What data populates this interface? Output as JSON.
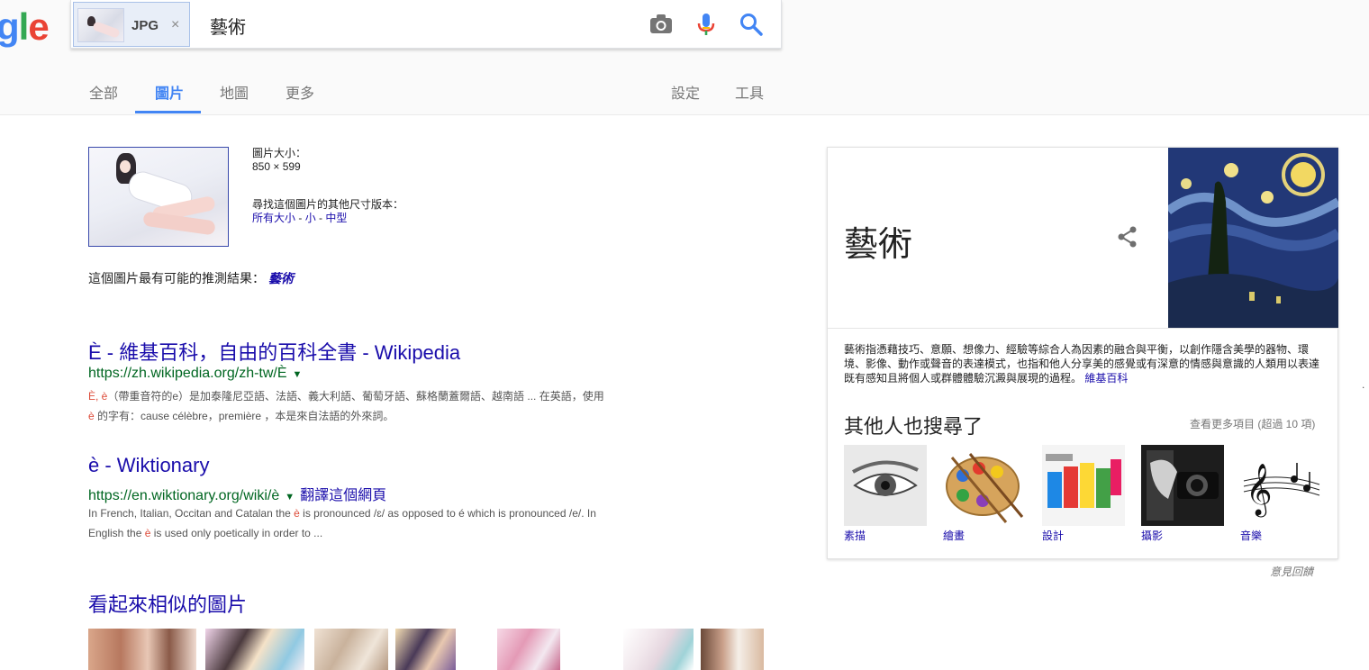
{
  "logo": {
    "text_partial": [
      "g",
      "l",
      "e"
    ]
  },
  "search": {
    "chip_label": "JPG",
    "chip_close": "×",
    "query": "藝術"
  },
  "tabs": [
    {
      "label": "全部"
    },
    {
      "label": "圖片"
    },
    {
      "label": "地圖"
    },
    {
      "label": "更多"
    },
    {
      "label": "設定"
    },
    {
      "label": "工具"
    }
  ],
  "image_info": {
    "size_label": "圖片大小：",
    "size_value": "850 × 599",
    "other_sizes_label": "尋找這個圖片的其他尺寸版本：",
    "size_links": [
      "所有大小",
      " - ",
      "小",
      " - ",
      "中型"
    ]
  },
  "best_guess": {
    "label": "這個圖片最有可能的推測結果：",
    "link": "藝術"
  },
  "results": [
    {
      "title": "È - 維基百科，自由的百科全書 - Wikipedia",
      "url": "https://zh.wikipedia.org/zh-tw/È",
      "caret": "▼",
      "snippet_line1_hl": "È, è",
      "snippet_line1": "（帶重音符的e）是加泰隆尼亞語、法語、義大利語、葡萄牙語、蘇格蘭蓋爾語、越南語 ... 在英語，使用",
      "snippet_line2_hl": "è",
      "snippet_line2": " 的字有：cause célèbre，première ，本是來自法語的外來詞。"
    },
    {
      "title": "è - Wiktionary",
      "url": "https://en.wiktionary.org/wiki/è",
      "caret": "▼",
      "translate": "翻譯這個網頁",
      "snippet_a": "In French, Italian, Occitan and Catalan the ",
      "snippet_hl1": "è",
      "snippet_b": " is pronounced /ɛ/ as opposed to é which is pronounced /e/. In",
      "snippet_c": "English the ",
      "snippet_hl2": "è",
      "snippet_d": " is used only poetically in order to ..."
    }
  ],
  "similar_heading": "看起來相似的圖片",
  "knowledge_panel": {
    "title": "藝術",
    "description": "藝術指憑藉技巧、意願、想像力、經驗等綜合人為因素的融合與平衡，以創作隱含美學的器物、環境、影像、動作或聲音的表達模式，也指和他人分享美的感覺或有深意的情感與意識的人類用以表達既有感知且將個人或群體體驗沉澱與展現的過程。",
    "source_link": "維基百科",
    "also_searched": "其他人也搜尋了",
    "see_more": "查看更多項目 (超過 10 項)",
    "tiles": [
      {
        "label": "素描"
      },
      {
        "label": "繪畫"
      },
      {
        "label": "設計"
      },
      {
        "label": "攝影"
      },
      {
        "label": "音樂"
      }
    ]
  },
  "feedback": "意見回饋",
  "colors": {
    "link": "#1a0dab",
    "url_green": "#006621",
    "accent_blue": "#4285f4",
    "highlight_red": "#dd4b39"
  }
}
